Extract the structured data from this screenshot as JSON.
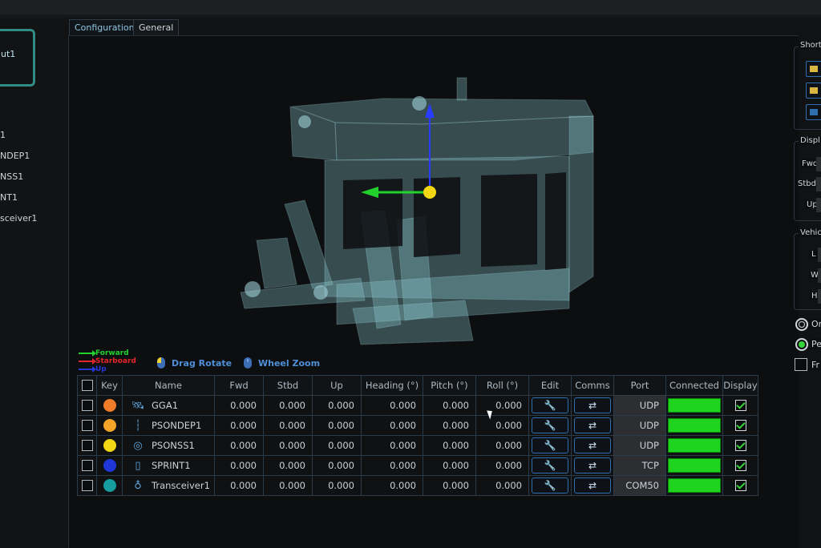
{
  "left_panel": {
    "selected_label": "ut1",
    "items": [
      "1",
      "NDEP1",
      "NSS1",
      "NT1",
      "sceiver1"
    ]
  },
  "tabs": [
    {
      "label": "Configuration",
      "active": true
    },
    {
      "label": "General",
      "active": false
    }
  ],
  "legend": {
    "forward": "Forward",
    "starboard": "Starboard",
    "up": "Up",
    "drag_rotate": "Drag Rotate",
    "wheel_zoom": "Wheel Zoom",
    "colors": {
      "forward": "#22d12c",
      "starboard": "#e2262a",
      "up": "#2638d8"
    }
  },
  "table": {
    "columns": [
      "",
      "Key",
      "Name",
      "Fwd",
      "Stbd",
      "Up",
      "Heading (°)",
      "Pitch (°)",
      "Roll (°)",
      "Edit",
      "Comms",
      "Port",
      "Connected",
      "Display"
    ],
    "rows": [
      {
        "name": "GGA1",
        "key_color": "#f07c2a",
        "icon": "gps-antenna-icon",
        "fwd": "0.000",
        "stbd": "0.000",
        "up": "0.000",
        "heading": "0.000",
        "pitch": "0.000",
        "roll": "0.000",
        "port": "UDP"
      },
      {
        "name": "PSONDEP1",
        "key_color": "#f4a528",
        "icon": "depth-sensor-icon",
        "fwd": "0.000",
        "stbd": "0.000",
        "up": "0.000",
        "heading": "0.000",
        "pitch": "0.000",
        "roll": "0.000",
        "port": "UDP"
      },
      {
        "name": "PSONSS1",
        "key_color": "#f1d812",
        "icon": "sound-speed-icon",
        "fwd": "0.000",
        "stbd": "0.000",
        "up": "0.000",
        "heading": "0.000",
        "pitch": "0.000",
        "roll": "0.000",
        "port": "UDP"
      },
      {
        "name": "SPRINT1",
        "key_color": "#1f37d8",
        "icon": "ins-cylinder-icon",
        "fwd": "0.000",
        "stbd": "0.000",
        "up": "0.000",
        "heading": "0.000",
        "pitch": "0.000",
        "roll": "0.000",
        "port": "TCP"
      },
      {
        "name": "Transceiver1",
        "key_color": "#169ea0",
        "icon": "transceiver-icon",
        "fwd": "0.000",
        "stbd": "0.000",
        "up": "0.000",
        "heading": "0.000",
        "pitch": "0.000",
        "roll": "0.000",
        "port": "COM50"
      }
    ]
  },
  "right_panel": {
    "shortcuts_label": "Short",
    "display_label": "Displ",
    "display_fields": [
      "Fwd",
      "Stbd",
      "Up"
    ],
    "vehicle_label": "Vehic",
    "vehicle_fields": [
      "L",
      "W",
      "H"
    ],
    "radio_1": "Or",
    "radio_2": "Pe",
    "checkbox_1": "Fr"
  }
}
